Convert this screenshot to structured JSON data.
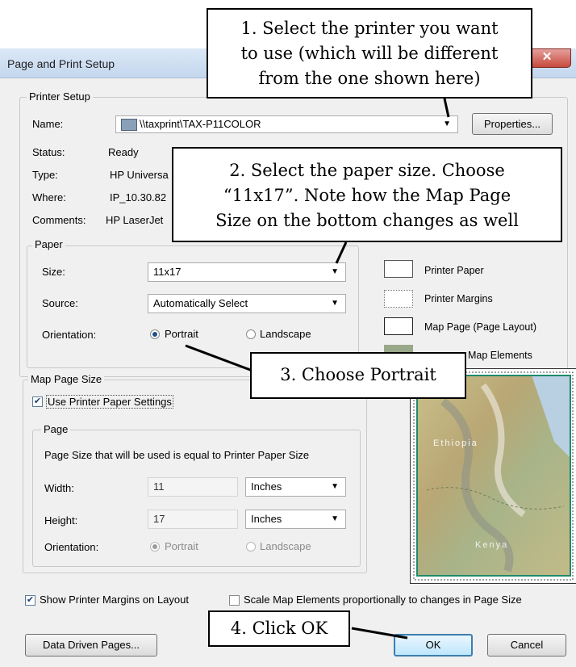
{
  "window": {
    "title": "Page and Print Setup",
    "close_glyph": "✕"
  },
  "printer_setup": {
    "group_label": "Printer Setup",
    "name_label": "Name:",
    "name_value": "\\\\taxprint\\TAX-P11COLOR",
    "properties_label": "Properties...",
    "status_label": "Status:",
    "status_value": "Ready",
    "type_label": "Type:",
    "type_value": "HP Universa",
    "where_label": "Where:",
    "where_value": "IP_10.30.82",
    "comments_label": "Comments:",
    "comments_value": "HP LaserJet",
    "paper": {
      "group_label": "Paper",
      "size_label": "Size:",
      "size_value": "11x17",
      "source_label": "Source:",
      "source_value": "Automatically Select",
      "orientation_label": "Orientation:",
      "portrait_label": "Portrait",
      "landscape_label": "Landscape"
    }
  },
  "legend": {
    "printer_paper": "Printer Paper",
    "printer_margins": "Printer Margins",
    "map_page": "Map Page (Page Layout)",
    "map_elements": "Map Elements"
  },
  "preview": {
    "label1": "Ethiopia",
    "label2": "Kenya"
  },
  "map_page_size": {
    "group_label": "Map Page Size",
    "use_printer_settings_label": "Use Printer Paper Settings",
    "page_group_label": "Page",
    "page_size_note": "Page Size that will be used is equal to Printer Paper Size",
    "width_label": "Width:",
    "width_value": "11",
    "width_unit": "Inches",
    "height_label": "Height:",
    "height_value": "17",
    "height_unit": "Inches",
    "orientation_label": "Orientation:",
    "portrait_label": "Portrait",
    "landscape_label": "Landscape"
  },
  "bottom": {
    "show_margins_label": "Show Printer Margins on Layout",
    "scale_elements_label": "Scale Map Elements proportionally to changes in Page Size",
    "data_driven_label": "Data Driven Pages...",
    "ok_label": "OK",
    "cancel_label": "Cancel"
  },
  "callouts": {
    "step1_line1": "1. Select the printer you want",
    "step1_line2": "to use (which will be different",
    "step1_line3": "from the one shown here)",
    "step2_line1": "2. Select the paper size. Choose",
    "step2_line2": "“11x17”. Note how the Map Page",
    "step2_line3": "Size on the bottom changes as well",
    "step3": "3. Choose Portrait",
    "step4": "4. Click OK"
  }
}
